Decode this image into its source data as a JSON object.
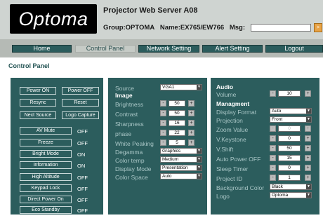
{
  "header": {
    "logo_text": "Optoma",
    "title": "Projector Web Server A08",
    "group": "Group:OPTOMA",
    "name": "Name:EX765/EW766",
    "msg_label": "Msg:",
    "msg_value": "",
    "msg_button": ">"
  },
  "nav": {
    "tabs": [
      "Home",
      "Control Panel",
      "Network Setting",
      "Alert Setting",
      "Logout"
    ],
    "active": "Control Panel"
  },
  "page_heading": "Control Panel",
  "left_panel": {
    "buttons": [
      "Power ON",
      "Power OFF",
      "Resync",
      "Reset",
      "Next Source",
      "Logo Capture"
    ],
    "toggles": [
      {
        "label": "AV Mute",
        "state": "OFF"
      },
      {
        "label": "Freeze",
        "state": "OFF"
      },
      {
        "label": "Bright Mode",
        "state": "ON"
      },
      {
        "label": "Information",
        "state": "ON"
      },
      {
        "label": "High Altitude",
        "state": "OFF"
      },
      {
        "label": "Keypad Lock",
        "state": "OFF"
      },
      {
        "label": "Direct Power On",
        "state": "OFF"
      },
      {
        "label": "Eco Standby",
        "state": "OFF"
      }
    ]
  },
  "image_panel": {
    "source_label": "Source",
    "source_value": "VGA1",
    "section": "Image",
    "steppers": [
      {
        "label": "Brightness",
        "value": "50"
      },
      {
        "label": "Contrast",
        "value": "50"
      },
      {
        "label": "Sharpness",
        "value": "16"
      },
      {
        "label": "phase",
        "value": "22"
      },
      {
        "label": "White Peaking",
        "value": "5"
      }
    ],
    "selects": [
      {
        "label": "Degamma",
        "value": "Graphics"
      },
      {
        "label": "Color temp",
        "value": "Medium"
      },
      {
        "label": "Display Mode",
        "value": "Presentation"
      },
      {
        "label": "Color Space",
        "value": "Auto"
      }
    ]
  },
  "right_panel": {
    "audio_section": "Audio",
    "volume_label": "Volume",
    "volume_value": "10",
    "mgmt_section": "Managment",
    "display_format_label": "Display Format",
    "display_format_value": "Auto",
    "projection_label": "Projection",
    "projection_value": "Front",
    "steppers": [
      {
        "label": "Zoom Value",
        "value": "0",
        "disabled": true
      },
      {
        "label": "V.Keystone",
        "value": "0",
        "disabled": false
      },
      {
        "label": "V.Shift",
        "value": "50",
        "disabled": false
      },
      {
        "label": "Auto Power OFF",
        "value": "15",
        "disabled": false
      },
      {
        "label": "Sleep Timer",
        "value": "0",
        "disabled": false
      },
      {
        "label": "Project ID",
        "value": "1",
        "disabled": false
      }
    ],
    "bg_color_label": "Background Color",
    "bg_color_value": "Black",
    "logo_label": "Logo",
    "logo_value": "Optoma"
  },
  "icons": {
    "minus": "-",
    "plus": "+",
    "dropdown": "▼"
  },
  "colors": {
    "panel": "#2c5d5d",
    "header": "#cfd4d1",
    "nav": "#b5bab5",
    "label": "#a9c6c6"
  }
}
